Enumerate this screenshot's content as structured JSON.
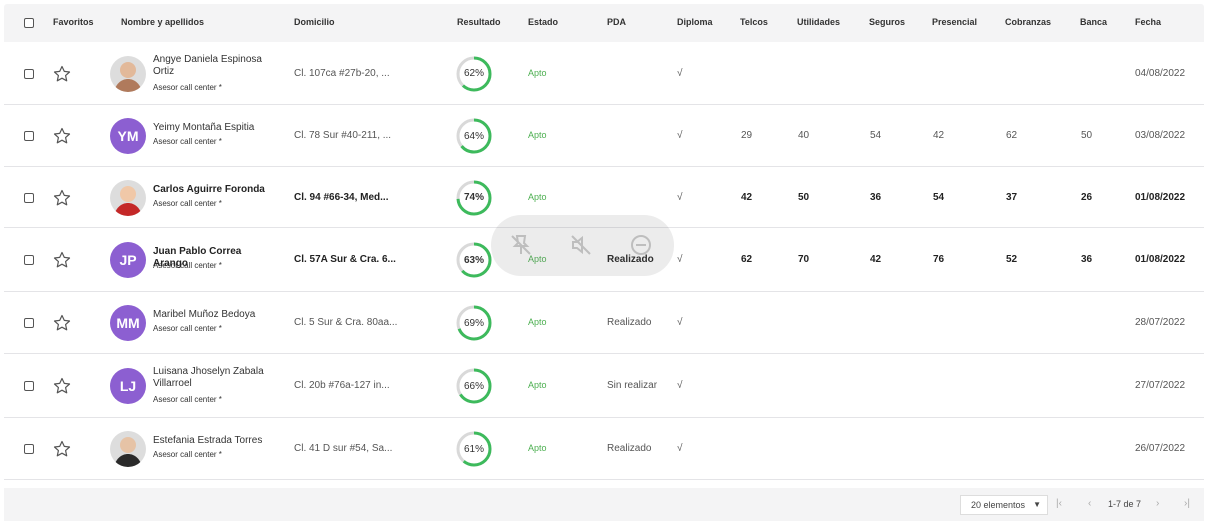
{
  "columns": {
    "favoritos": "Favoritos",
    "nombre": "Nombre y apellidos",
    "domicilio": "Domicilio",
    "resultado": "Resultado",
    "estado": "Estado",
    "pda": "PDA",
    "diploma": "Diploma",
    "telcos": "Telcos",
    "utilidades": "Utilidades",
    "seguros": "Seguros",
    "presencial": "Presencial",
    "cobranzas": "Cobranzas",
    "banca": "Banca",
    "fecha": "Fecha"
  },
  "rows": [
    {
      "name": "Angye Daniela Espinosa Ortiz",
      "role": "Asesor call center *",
      "avatar": "photo",
      "address": "Cl. 107ca #27b-20, ...",
      "result": "62%",
      "result_value": 0.62,
      "estado": "Apto",
      "pda": "",
      "diploma": "√",
      "telcos": "",
      "utilidades": "",
      "seguros": "",
      "presencial": "",
      "cobranzas": "",
      "banca": "",
      "fecha": "04/08/2022",
      "bold": false
    },
    {
      "name": "Yeimy Montaña Espitia",
      "role": "Asesor call center *",
      "avatar": "YM",
      "address": "Cl. 78 Sur #40-211, ...",
      "result": "64%",
      "result_value": 0.64,
      "estado": "Apto",
      "pda": "",
      "diploma": "√",
      "telcos": "29",
      "utilidades": "40",
      "seguros": "54",
      "presencial": "42",
      "cobranzas": "62",
      "banca": "50",
      "fecha": "03/08/2022",
      "bold": false
    },
    {
      "name": "Carlos Aguirre Foronda",
      "role": "Asesor call center *",
      "avatar": "photo",
      "address": "Cl. 94 #66-34, Med...",
      "result": "74%",
      "result_value": 0.74,
      "estado": "Apto",
      "pda": "",
      "diploma": "√",
      "telcos": "42",
      "utilidades": "50",
      "seguros": "36",
      "presencial": "54",
      "cobranzas": "37",
      "banca": "26",
      "fecha": "01/08/2022",
      "bold": true
    },
    {
      "name": "Juan Pablo Correa Arango",
      "role": "Asesor call center *",
      "avatar": "JP",
      "address": "Cl. 57A Sur & Cra. 6...",
      "result": "63%",
      "result_value": 0.63,
      "estado": "Apto",
      "pda": "Realizado",
      "diploma": "√",
      "telcos": "62",
      "utilidades": "70",
      "seguros": "42",
      "presencial": "76",
      "cobranzas": "52",
      "banca": "36",
      "fecha": "01/08/2022",
      "bold": true
    },
    {
      "name": "Maribel Muñoz Bedoya",
      "role": "Asesor call center *",
      "avatar": "MM",
      "address": "Cl. 5 Sur & Cra. 80aa...",
      "result": "69%",
      "result_value": 0.69,
      "estado": "Apto",
      "pda": "Realizado",
      "diploma": "√",
      "telcos": "",
      "utilidades": "",
      "seguros": "",
      "presencial": "",
      "cobranzas": "",
      "banca": "",
      "fecha": "28/07/2022",
      "bold": false
    },
    {
      "name": "Luisana Jhoselyn Zabala Villarroel",
      "role": "Asesor call center *",
      "avatar": "LJ",
      "address": "Cl. 20b #76a-127 in...",
      "result": "66%",
      "result_value": 0.66,
      "estado": "Apto",
      "pda": "Sin realizar",
      "diploma": "√",
      "telcos": "",
      "utilidades": "",
      "seguros": "",
      "presencial": "",
      "cobranzas": "",
      "banca": "",
      "fecha": "27/07/2022",
      "bold": false
    },
    {
      "name": "Estefania Estrada Torres",
      "role": "Asesor call center *",
      "avatar": "photo",
      "address": "Cl. 41 D sur #54, Sa...",
      "result": "61%",
      "result_value": 0.61,
      "estado": "Apto",
      "pda": "Realizado",
      "diploma": "√",
      "telcos": "",
      "utilidades": "",
      "seguros": "",
      "presencial": "",
      "cobranzas": "",
      "banca": "",
      "fecha": "26/07/2022",
      "bold": false
    }
  ],
  "pagination": {
    "page_size": "20 elementos",
    "info": "1-7 de 7"
  },
  "colors": {
    "ring_progress": "#3dba5c",
    "ring_track": "#d9d9d9",
    "avatar_bg": "#8c5fd1",
    "apto": "#4caf50"
  },
  "media_overlay_icons": [
    "pin-off-icon",
    "mute-icon",
    "stop-icon"
  ]
}
